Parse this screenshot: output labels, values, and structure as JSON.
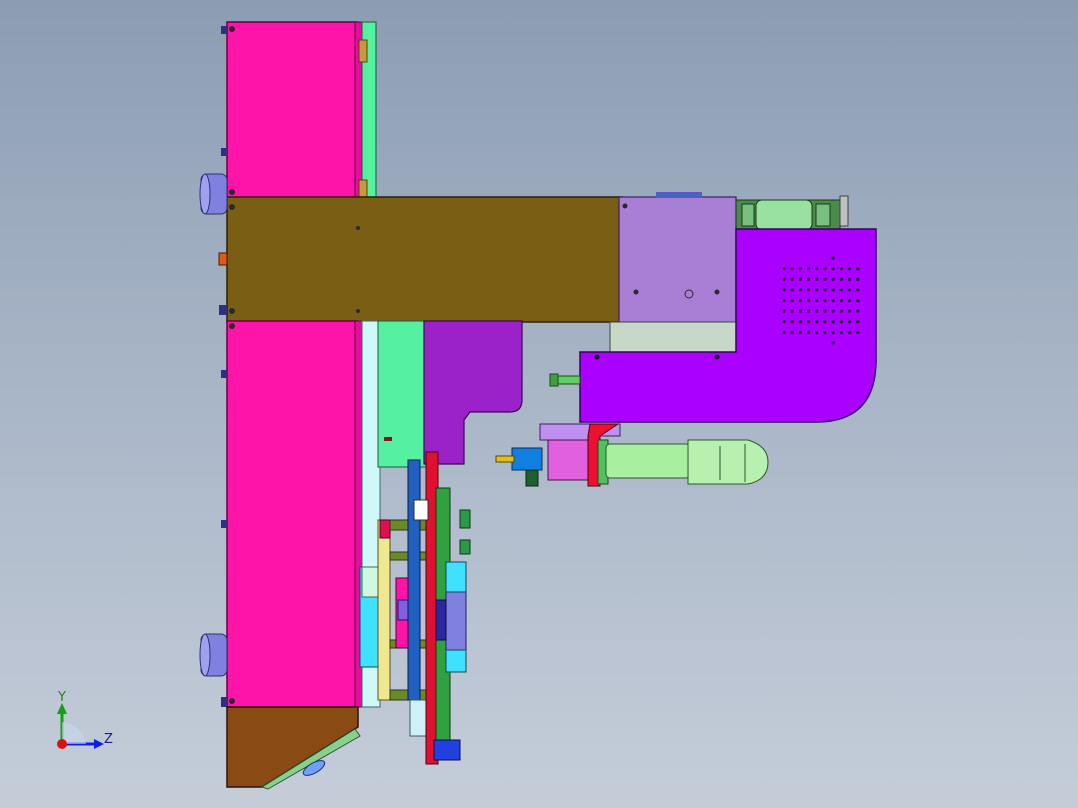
{
  "viewport": {
    "background_top": "#8c9db3",
    "background_bottom": "#c5cdd9"
  },
  "triad": {
    "y_label": "Y",
    "z_label": "Z",
    "colors": {
      "x": "#e01010",
      "y": "#10a010",
      "z": "#1020e0"
    }
  },
  "model": {
    "colors": {
      "magenta": "#ff14aa",
      "olive": "#7a5e14",
      "lavender": "#a97fd6",
      "purple": "#aa00ff",
      "green": "#55f0a0",
      "dark_purple": "#9b22c8",
      "brown": "#8a4a14",
      "light_green": "#a8f0a0",
      "pink_block": "#e060e0",
      "cyan": "#40e0ff",
      "red": "#e01030",
      "blue_gray": "#8080e0"
    }
  }
}
